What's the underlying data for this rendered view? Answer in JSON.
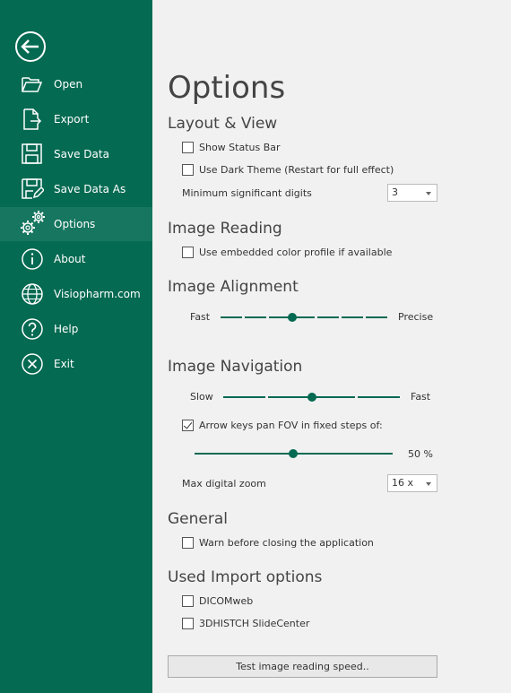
{
  "sidebar": {
    "items": [
      {
        "label": "Open",
        "icon": "folder-open-icon"
      },
      {
        "label": "Export",
        "icon": "export-icon"
      },
      {
        "label": "Save Data",
        "icon": "save-icon"
      },
      {
        "label": "Save Data As",
        "icon": "save-as-icon"
      },
      {
        "label": "Options",
        "icon": "gears-icon",
        "active": true
      },
      {
        "label": "About",
        "icon": "info-icon"
      },
      {
        "label": "Visiopharm.com",
        "icon": "globe-icon"
      },
      {
        "label": "Help",
        "icon": "help-icon"
      },
      {
        "label": "Exit",
        "icon": "exit-icon"
      }
    ]
  },
  "main": {
    "title": "Options",
    "layout_view": {
      "heading": "Layout & View",
      "show_status_bar": {
        "label": "Show Status Bar",
        "checked": false
      },
      "dark_theme": {
        "label": "Use Dark Theme (Restart for full effect)",
        "checked": false
      },
      "min_digits_label": "Minimum significant digits",
      "min_digits_value": "3"
    },
    "image_reading": {
      "heading": "Image Reading",
      "embedded_profile": {
        "label": "Use embedded color profile if available",
        "checked": false
      }
    },
    "image_alignment": {
      "heading": "Image Alignment",
      "left_label": "Fast",
      "right_label": "Precise",
      "level_fraction": 0.43
    },
    "image_navigation": {
      "heading": "Image Navigation",
      "left_label": "Slow",
      "right_label": "Fast",
      "speed_fraction": 0.5,
      "arrow_keys": {
        "label": "Arrow keys pan FOV in fixed steps of:",
        "checked": true
      },
      "step_percent": "50 %",
      "step_fraction": 0.5,
      "max_zoom_label": "Max digital zoom",
      "max_zoom_value": "16 x"
    },
    "general": {
      "heading": "General",
      "warn_close": {
        "label": "Warn before closing the application",
        "checked": false
      }
    },
    "import_options": {
      "heading": "Used Import options",
      "dicomweb": {
        "label": "DICOMweb",
        "checked": false
      },
      "slidecenter": {
        "label": "3DHISTCH SlideCenter",
        "checked": false
      }
    },
    "test_button": "Test image reading speed.."
  },
  "colors": {
    "sidebar_bg": "#046a52",
    "accent": "#046a52",
    "active_item": "#16765f"
  }
}
